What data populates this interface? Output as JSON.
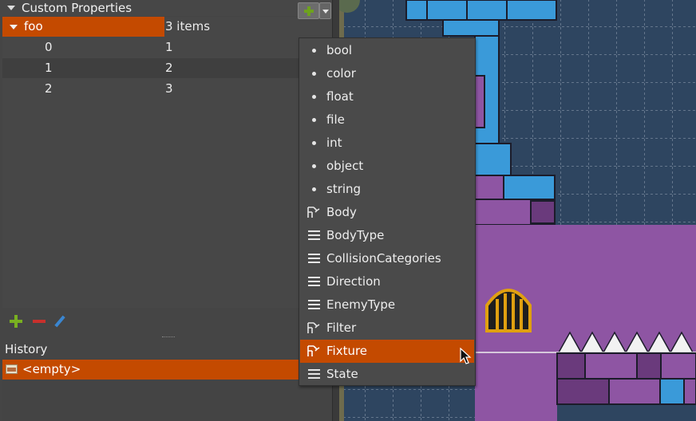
{
  "panel": {
    "title": "Custom Properties",
    "property": {
      "name": "foo",
      "value": "3 items"
    },
    "children": [
      {
        "key": "0",
        "value": "1"
      },
      {
        "key": "1",
        "value": "2"
      },
      {
        "key": "2",
        "value": "3"
      }
    ]
  },
  "history": {
    "title": "History",
    "entry": "<empty>"
  },
  "type_menu": {
    "items": [
      {
        "label": "bool",
        "icon": "dot-icon"
      },
      {
        "label": "color",
        "icon": "dot-icon"
      },
      {
        "label": "float",
        "icon": "dot-icon"
      },
      {
        "label": "file",
        "icon": "dot-icon"
      },
      {
        "label": "int",
        "icon": "dot-icon"
      },
      {
        "label": "object",
        "icon": "dot-icon"
      },
      {
        "label": "string",
        "icon": "dot-icon"
      },
      {
        "label": "Body",
        "icon": "class-icon"
      },
      {
        "label": "BodyType",
        "icon": "enum-icon"
      },
      {
        "label": "CollisionCategories",
        "icon": "enum-icon"
      },
      {
        "label": "Direction",
        "icon": "enum-icon"
      },
      {
        "label": "EnemyType",
        "icon": "enum-icon"
      },
      {
        "label": "Filter",
        "icon": "class-icon"
      },
      {
        "label": "Fixture",
        "icon": "class-icon",
        "selected": true
      },
      {
        "label": "State",
        "icon": "enum-icon"
      }
    ]
  },
  "colors": {
    "selection": "#c44a00",
    "map_background": "#2e4560",
    "wall_purple": "#8e55a3",
    "brick_blue": "#3a9ad9",
    "add_green": "#79b020",
    "remove_red": "#c9302c"
  }
}
